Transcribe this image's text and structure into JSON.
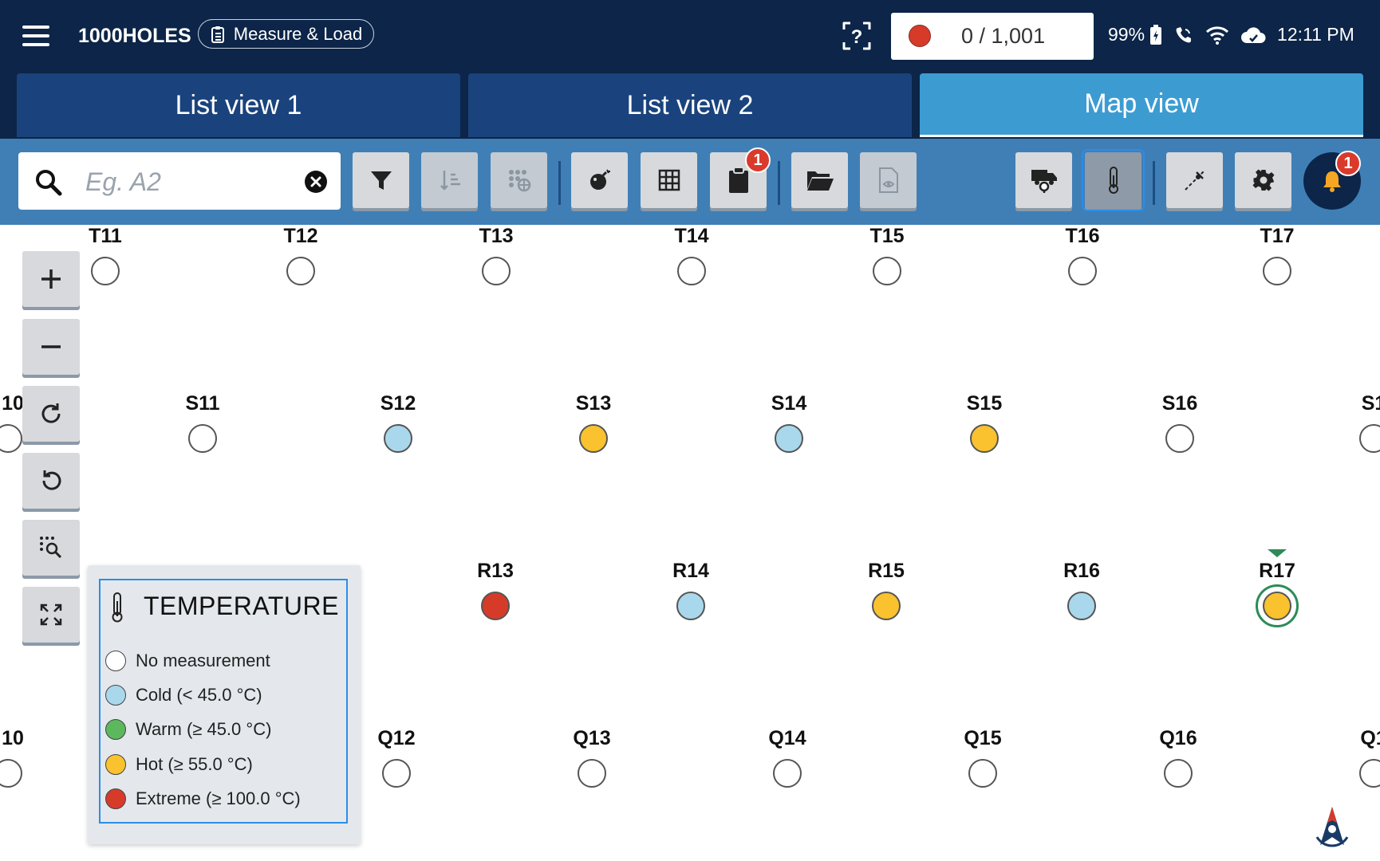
{
  "header": {
    "app_title": "1000HOLES",
    "mode_label": "Measure & Load",
    "counter_text": "0 / 1,001",
    "battery_pct": "99%",
    "time": "12:11 PM"
  },
  "tabs": [
    {
      "label": "List view 1",
      "active": false
    },
    {
      "label": "List view 2",
      "active": false
    },
    {
      "label": "Map view",
      "active": true
    }
  ],
  "toolbar": {
    "search_placeholder": "Eg. A2",
    "clipboard_badge": "1",
    "bell_badge": "1"
  },
  "colors": {
    "none": "#ffffff",
    "cold": "#a9d8ec",
    "warm": "#5cb85c",
    "hot": "#f9c22e",
    "extreme": "#d63b2a"
  },
  "legend": {
    "title": "TEMPERATURE",
    "items": [
      {
        "label": "No measurement",
        "color": "#ffffff"
      },
      {
        "label": "Cold (< 45.0 °C)",
        "color": "#a9d8ec"
      },
      {
        "label": "Warm (≥ 45.0 °C)",
        "color": "#5cb85c"
      },
      {
        "label": "Hot (≥ 55.0 °C)",
        "color": "#f9c22e"
      },
      {
        "label": "Extreme (≥ 100.0 °C)",
        "color": "#d63b2a"
      }
    ]
  },
  "map": {
    "row_T": {
      "T11": "none",
      "T12": "none",
      "T13": "none",
      "T14": "none",
      "T15": "none",
      "T16": "none",
      "T17": "none"
    },
    "row_S": {
      "S10": "none",
      "S11": "none",
      "S12": "cold",
      "S13": "hot",
      "S14": "cold",
      "S15": "hot",
      "S16": "none",
      "S17": "none"
    },
    "row_R": {
      "R11": "none",
      "R12": "none",
      "R13": "extreme",
      "R14": "cold",
      "R15": "hot",
      "R16": "cold",
      "R17": "hot"
    },
    "row_Q": {
      "Q10": "none",
      "Q11": "none",
      "Q12": "none",
      "Q13": "none",
      "Q14": "none",
      "Q15": "none",
      "Q16": "none",
      "Q17": "none"
    },
    "labels": {
      "T11": "T11",
      "T12": "T12",
      "T13": "T13",
      "T14": "T14",
      "T15": "T15",
      "T16": "T16",
      "T17": "T17",
      "S10": "10",
      "S11": "S11",
      "S12": "S12",
      "S13": "S13",
      "S14": "S14",
      "S15": "S15",
      "S16": "S16",
      "S17": "S1",
      "R13": "R13",
      "R14": "R14",
      "R15": "R15",
      "R16": "R16",
      "R17": "R17",
      "Q10": "10",
      "Q12": "Q12",
      "Q13": "Q13",
      "Q14": "Q14",
      "Q15": "Q15",
      "Q16": "Q16",
      "Q17": "Q1"
    },
    "selected_hole": "R17"
  }
}
